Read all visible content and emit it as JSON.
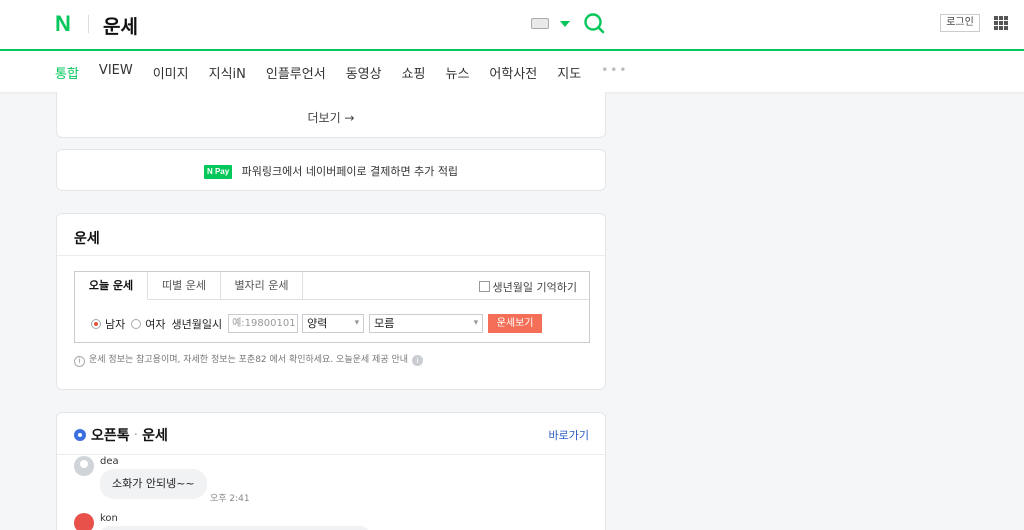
{
  "header": {
    "logo": "N",
    "query": "운세",
    "login": "로그인",
    "icons": {
      "keyboard": "keyboard-icon",
      "search": "search-icon",
      "apps": "apps-grid-icon"
    }
  },
  "nav": {
    "tabs": [
      "통합",
      "VIEW",
      "이미지",
      "지식iN",
      "인플루언서",
      "동영상",
      "쇼핑",
      "뉴스",
      "어학사전",
      "지도"
    ],
    "active": "통합",
    "more": "•••"
  },
  "more_card": {
    "label": "더보기 →"
  },
  "pay_card": {
    "badge": "N Pay",
    "text": "파워링크에서 네이버페이로 결제하면 추가 적립"
  },
  "fortune": {
    "title": "운세",
    "tabs": [
      "오늘 운세",
      "띠별 운세",
      "별자리 운세"
    ],
    "remember": "생년월일 기억하기",
    "gender_male": "남자",
    "gender_female": "여자",
    "birth_label": "생년월일시",
    "birth_placeholder": "예:19800101",
    "calendar": "양력",
    "time": "모름",
    "submit": "운세보기",
    "notice": "운세 정보는 참고용이며, 자세한 정보는 포춘82 에서 확인하세요.   오늘운세 제공 안내"
  },
  "openchat": {
    "title": "오픈톡",
    "dot": "·",
    "topic": "운세",
    "shortcut": "바로가기",
    "messages": [
      {
        "user": "dea",
        "text": "소화가 안되넹~~",
        "time": "오후 2:41"
      },
      {
        "user": "kon",
        "text": ""
      }
    ]
  },
  "colors": {
    "brand": "#03c75a",
    "button": "#f46e58",
    "link": "#2a5ac8"
  }
}
